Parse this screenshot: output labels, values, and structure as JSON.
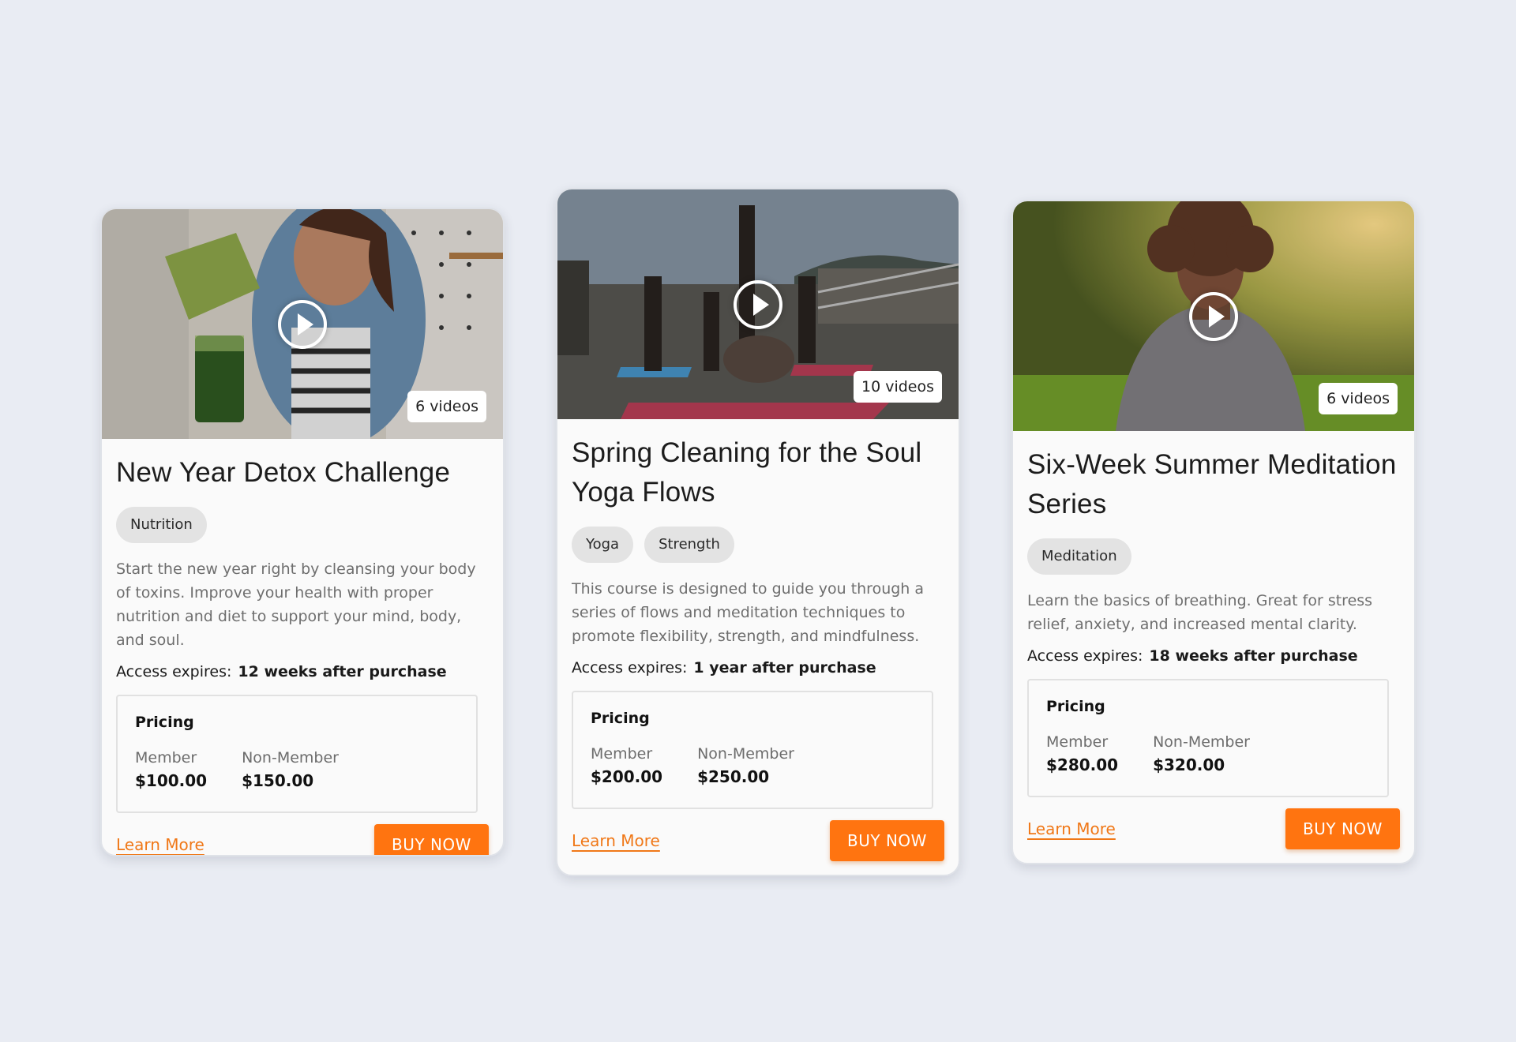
{
  "colors": {
    "accent": "#ff7410",
    "link": "#f07818",
    "background": "#e9ecf3",
    "card": "#fafafa"
  },
  "cards": [
    {
      "video_count": "6 videos",
      "title": "New Year Detox Challenge",
      "tags": [
        "Nutrition"
      ],
      "description": "Start the new year right by cleansing your body of toxins. Improve your health with proper nutrition and diet to support your mind, body, and soul.",
      "access_label": "Access expires:",
      "access_value": "12 weeks after purchase",
      "pricing_label": "Pricing",
      "member_label": "Member",
      "member_price": "$100.00",
      "nonmember_label": "Non-Member",
      "nonmember_price": "$150.00",
      "learn_more": "Learn More",
      "buy_now": "BUY NOW"
    },
    {
      "video_count": "10 videos",
      "title": "Spring Cleaning for the Soul Yoga Flows",
      "tags": [
        "Yoga",
        "Strength"
      ],
      "description": "This course is designed to guide you through a series of flows and meditation techniques to promote flexibility, strength, and mindfulness.",
      "access_label": "Access expires:",
      "access_value": "1 year after purchase",
      "pricing_label": "Pricing",
      "member_label": "Member",
      "member_price": "$200.00",
      "nonmember_label": "Non-Member",
      "nonmember_price": "$250.00",
      "learn_more": "Learn More",
      "buy_now": "BUY NOW"
    },
    {
      "video_count": "6 videos",
      "title": "Six-Week Summer Meditation Series",
      "tags": [
        "Meditation"
      ],
      "description": "Learn the basics of breathing. Great for stress relief, anxiety, and increased mental clarity.",
      "access_label": "Access expires:",
      "access_value": "18 weeks after purchase",
      "pricing_label": "Pricing",
      "member_label": "Member",
      "member_price": "$280.00",
      "nonmember_label": "Non-Member",
      "nonmember_price": "$320.00",
      "learn_more": "Learn More",
      "buy_now": "BUY NOW"
    }
  ]
}
